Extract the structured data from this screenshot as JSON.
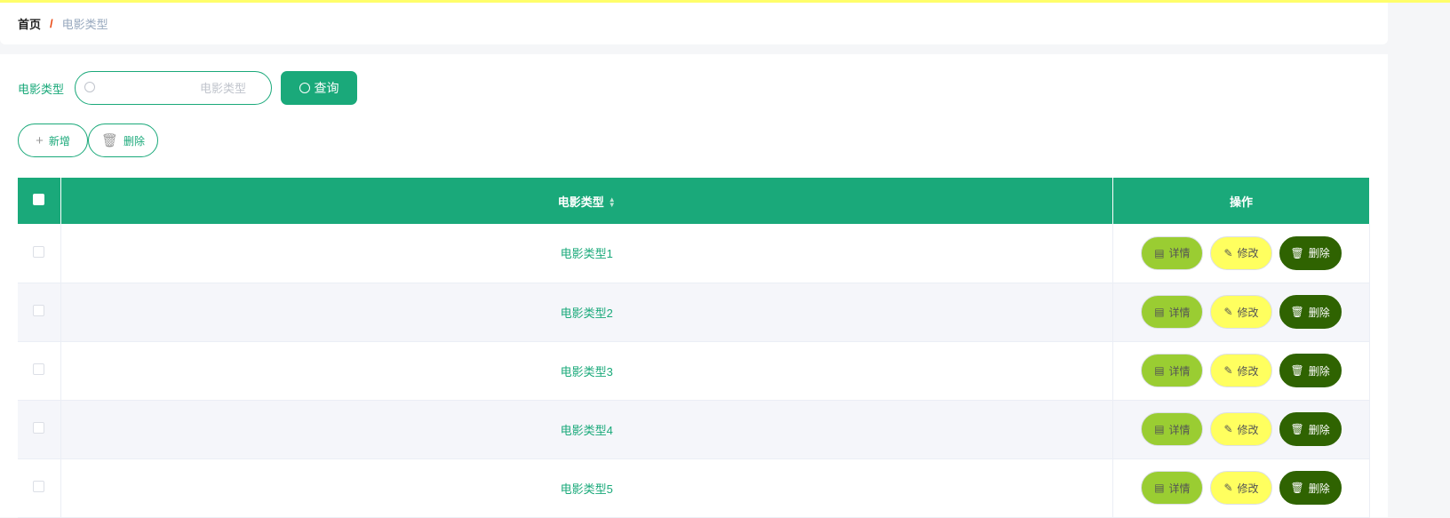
{
  "breadcrumb": {
    "home": "首页",
    "separator": "/",
    "current": "电影类型"
  },
  "search": {
    "label": "电影类型",
    "placeholder": "电影类型",
    "query_button": "查询"
  },
  "actions": {
    "add": "新增",
    "delete": "删除"
  },
  "table": {
    "columns": [
      "电影类型",
      "操作"
    ],
    "rows": [
      {
        "name": "电影类型1"
      },
      {
        "name": "电影类型2"
      },
      {
        "name": "电影类型3"
      },
      {
        "name": "电影类型4"
      },
      {
        "name": "电影类型5"
      }
    ],
    "row_actions": {
      "detail": "详情",
      "edit": "修改",
      "delete": "删除"
    }
  },
  "colors": {
    "accent": "#1aa97a",
    "detail": "#9acd32",
    "edit": "#ffff5f",
    "delete": "#2f6301"
  }
}
